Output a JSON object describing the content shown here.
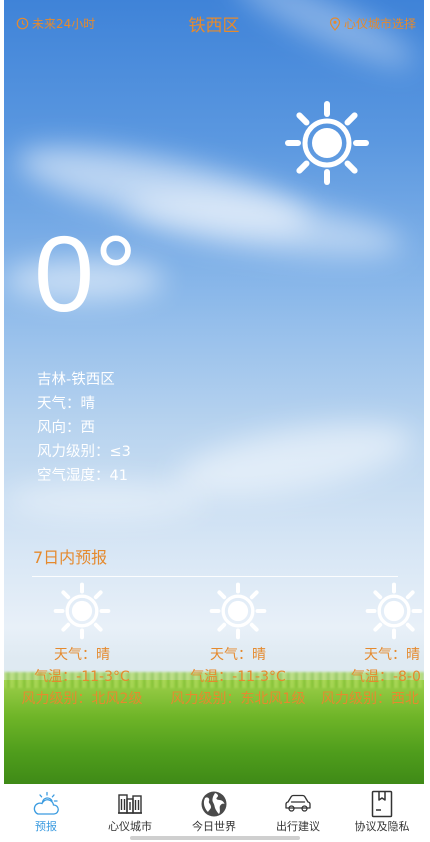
{
  "header": {
    "left_label": "未来24小时",
    "title": "铁西区",
    "right_label": "心仪城市选择"
  },
  "current": {
    "temperature": "0°",
    "location": "吉林-铁西区",
    "weather": "天气：晴",
    "wind_direction": "风向：西",
    "wind_level": "风力级别：≤3",
    "humidity": "空气湿度：41"
  },
  "forecast": {
    "title": "7日内预报",
    "days": [
      {
        "weather": "天气：晴",
        "temp": "气温：-11-3°C",
        "wind": "风力级别：北风2级"
      },
      {
        "weather": "天气：晴",
        "temp": "气温：-11-3°C",
        "wind": "风力级别：东北风1级"
      },
      {
        "weather": "天气：晴",
        "temp": "气温：-8-0",
        "wind": "风力级别：西北"
      }
    ]
  },
  "tabs": [
    {
      "label": "预报",
      "icon": "cloud-sun-icon",
      "active": true
    },
    {
      "label": "心仪城市",
      "icon": "buildings-icon",
      "active": false
    },
    {
      "label": "今日世界",
      "icon": "globe-icon",
      "active": false
    },
    {
      "label": "出行建议",
      "icon": "car-icon",
      "active": false
    },
    {
      "label": "协议及隐私",
      "icon": "document-icon",
      "active": false
    }
  ],
  "colors": {
    "accent_orange": "#e58a2e",
    "active_tab_blue": "#3a9be0"
  }
}
